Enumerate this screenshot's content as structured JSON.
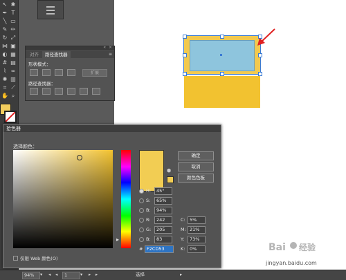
{
  "pathfinder_panel": {
    "tabs": [
      "对齐",
      "路径查找器"
    ],
    "shape_modes_label": "形状模式：",
    "pathfinders_label": "路径查找器：",
    "expand_label": "扩展"
  },
  "color_picker": {
    "title": "拾色器",
    "choose_color_label": "选择颜色：",
    "ok_label": "确定",
    "cancel_label": "取消",
    "swatches_label": "颜色色板",
    "fields": {
      "H": {
        "label": "H:",
        "value": "45°"
      },
      "S": {
        "label": "S:",
        "value": "65%"
      },
      "B": {
        "label": "B:",
        "value": "94%"
      },
      "R": {
        "label": "R:",
        "value": "242"
      },
      "G": {
        "label": "G:",
        "value": "205"
      },
      "Bl": {
        "label": "B:",
        "value": "83"
      },
      "C": {
        "label": "C:",
        "value": "5%"
      },
      "M": {
        "label": "M:",
        "value": "21%"
      },
      "Y": {
        "label": "Y:",
        "value": "73%"
      },
      "K": {
        "label": "K:",
        "value": "0%"
      },
      "hex": {
        "label": "#",
        "value": "F2CD53"
      }
    },
    "web_only_label": "仅限 Web 颜色(O)",
    "current_color": "#f2cd53"
  },
  "statusbar": {
    "zoom": "94%",
    "page": "1",
    "status": "选择"
  },
  "watermark": {
    "logo": "Baidu 经验",
    "url": "jingyan.baidu.com"
  },
  "colors": {
    "accent_selection": "#3a7bd5",
    "yellow": "#f2c230",
    "blue_fill": "#8ec5dd",
    "arrow": "#e02020"
  }
}
